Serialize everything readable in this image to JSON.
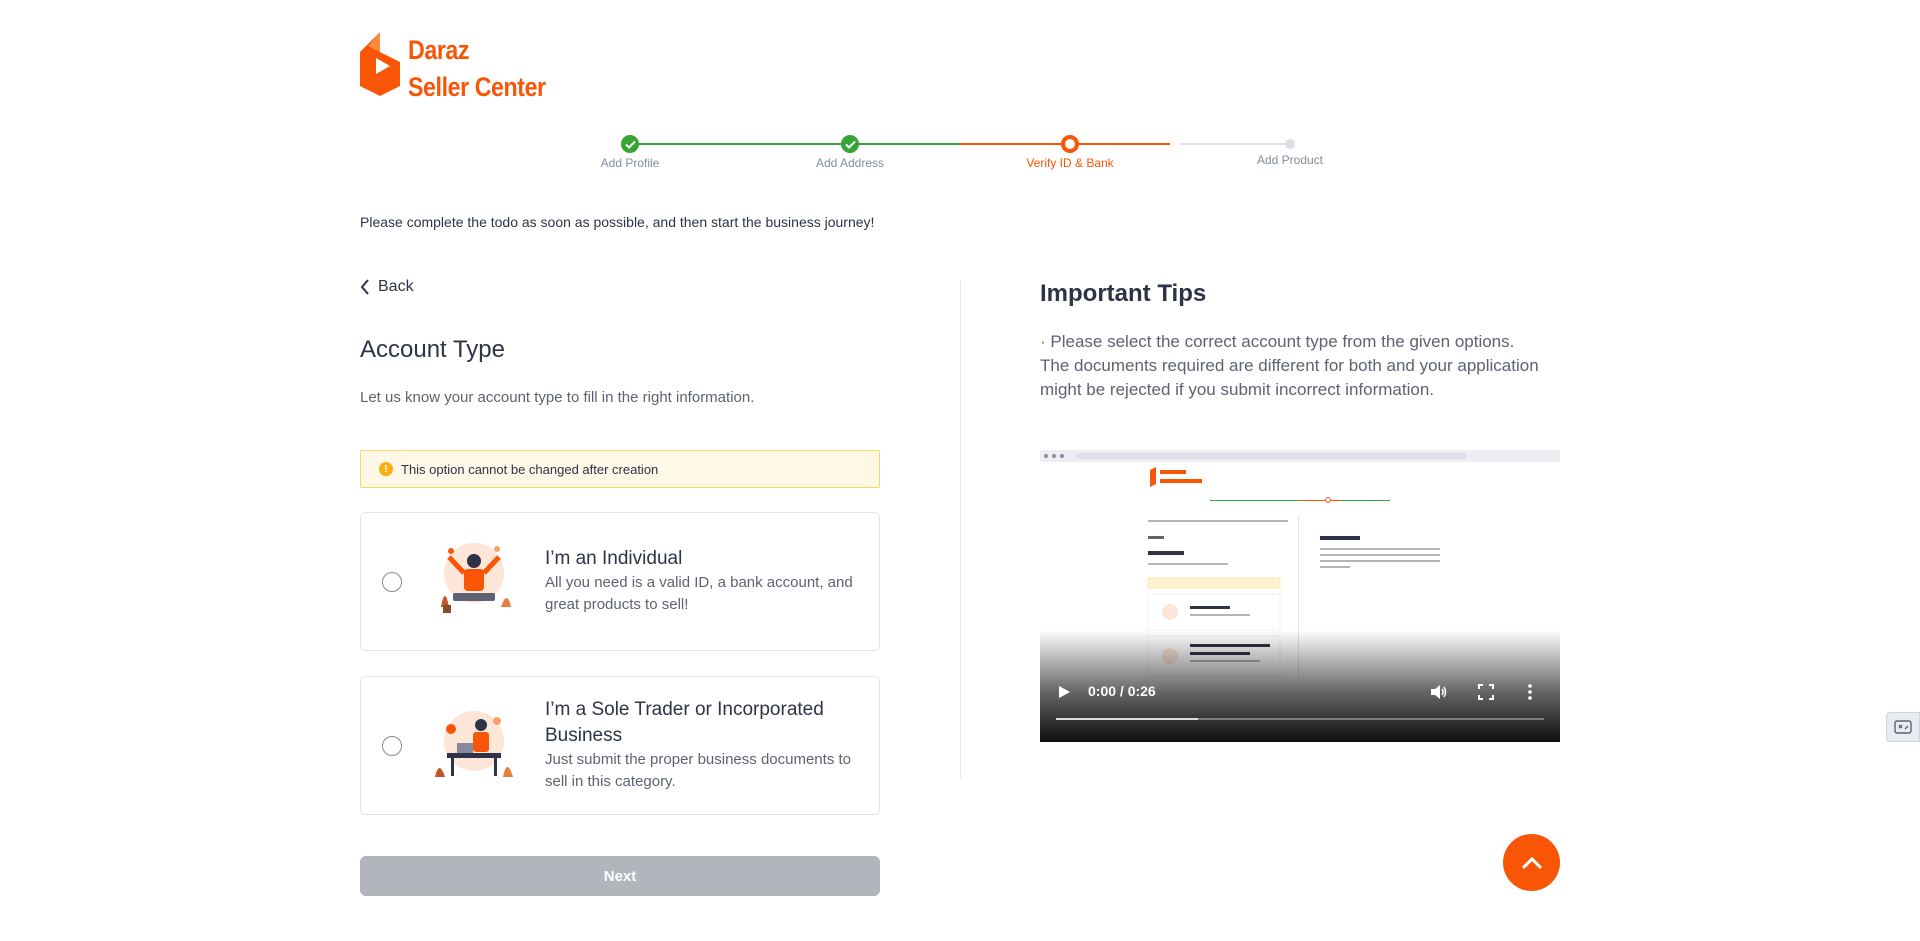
{
  "brand": {
    "line1": "Daraz",
    "line2": "Seller Center",
    "color": "#f85606"
  },
  "stepper": {
    "steps": [
      {
        "label": "Add Profile",
        "state": "done"
      },
      {
        "label": "Add Address",
        "state": "done"
      },
      {
        "label": "Verify ID & Bank",
        "state": "active"
      },
      {
        "label": "Add Product",
        "state": "todo"
      }
    ]
  },
  "intro": "Please complete the todo as soon as possible, and then start the business journey!",
  "form": {
    "back_label": "Back",
    "title": "Account Type",
    "subtitle": "Let us know your account type to fill in the right information.",
    "warning": "This option cannot be changed after creation",
    "options": [
      {
        "title": "I’m an Individual",
        "desc": "All you need is a valid ID, a bank account, and great products to sell!",
        "selected": false
      },
      {
        "title": "I’m a Sole Trader or Incorporated Business",
        "desc": "Just submit the proper business documents to sell in this category.",
        "selected": false
      }
    ],
    "next_label": "Next"
  },
  "tips": {
    "title": "Important Tips",
    "body": "· Please select the correct account type from the given options. The documents required are different for both and your application might be rejected if you submit incorrect information."
  },
  "video": {
    "time": "0:00 / 0:26",
    "buffered_fraction": 0.29,
    "played_fraction": 0
  },
  "colors": {
    "accent": "#f85606",
    "done": "#35a535",
    "disabled": "#b2b5bc",
    "warning_bg": "#fff8e6"
  }
}
